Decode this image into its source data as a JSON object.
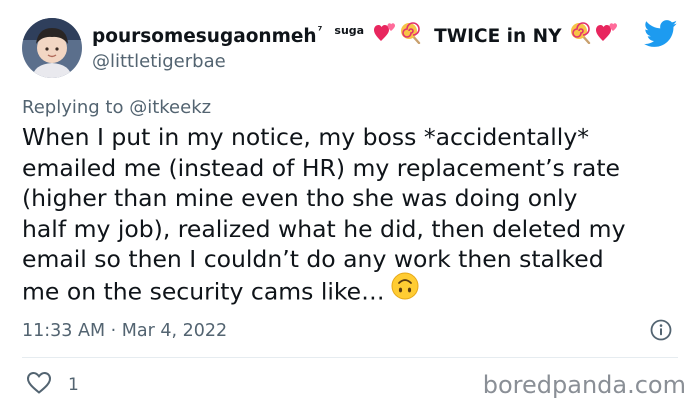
{
  "author": {
    "display_name": "poursomesugaonmeh",
    "sup_mark": "⁷",
    "sup_label": "suga",
    "name_suffix": "TWICE in NY",
    "handle": "@littletigerbae"
  },
  "reply": {
    "prefix": "Replying to ",
    "mention": "@itkeekz"
  },
  "tweet": {
    "lines": [
      "When I put in my notice, my boss *accidentally*",
      "emailed me (instead of HR) my replacement’s rate",
      "(higher than mine even tho she was doing only",
      "half my job), realized what he did, then deleted my",
      "email so then I couldn’t do any work then stalked",
      "me on the security cams like…"
    ],
    "timestamp": "11:33 AM · Mar 4, 2022",
    "likes": "1"
  },
  "icons": {
    "heart_emoji": "two-hearts-icon",
    "lollipop_emoji": "lollipop-icon",
    "upside_down_emoji": "upside-down-face-icon",
    "brand": "twitter-bird-icon",
    "info": "info-icon",
    "like": "heart-outline-icon"
  },
  "colors": {
    "text": "#0f1419",
    "secondary": "#536471",
    "twitter_blue": "#1d9bf0",
    "divider": "#e6ecf0"
  },
  "watermark": "boredpanda.com"
}
